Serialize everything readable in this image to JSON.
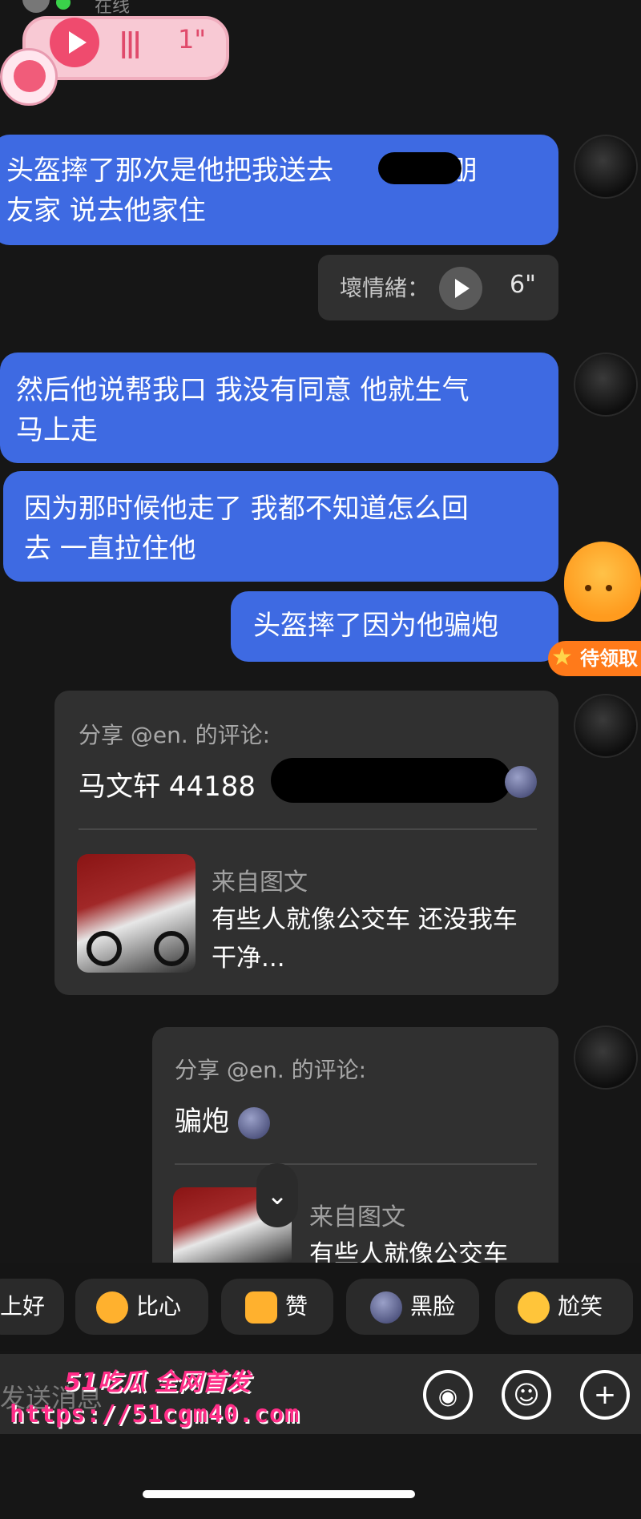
{
  "status": {
    "online_text": "在线"
  },
  "voice_message": {
    "duration": "1\""
  },
  "messages": [
    {
      "line1": "头盔摔了那次是他把我送去",
      "line1b": "他男朋",
      "line2": "友家 说去他家住"
    },
    {
      "line1": "然后他说帮我口 我没有同意 他就生气",
      "line2": "马上走"
    },
    {
      "line1": "因为那时候他走了 我都不知道怎么回",
      "line2": "去 一直拉住他"
    },
    {
      "line1": "头盔摔了因为他骗炮"
    }
  ],
  "voice_reply": {
    "label": "壞情緒：",
    "duration": "6\""
  },
  "reward_badge": "待领取",
  "shared_comments": [
    {
      "header": "分享 @en. 的评论:",
      "text": "马文轩 44188",
      "source_label": "来自图文",
      "post_line1": "有些人就像公交车 还没我车",
      "post_line2": "干净..."
    },
    {
      "header": "分享 @en. 的评论:",
      "text": "骗炮",
      "source_label": "来自图文",
      "post_line1": "有些人就像公交车"
    }
  ],
  "quick_replies": [
    "上好",
    "比心",
    "赞",
    "黑脸",
    "尬笑"
  ],
  "input": {
    "placeholder": "发送消息"
  },
  "watermark": {
    "line1": "51吃瓜 全网首发",
    "line2": "https://51cgm40.com"
  },
  "colors": {
    "bubble_blue": "#3e6ae2",
    "background": "#161616",
    "watermark": "#ff2d87"
  },
  "icons": [
    "play-icon",
    "voice-icon",
    "emoji-icon",
    "plus-icon",
    "chevron-down-icon"
  ]
}
